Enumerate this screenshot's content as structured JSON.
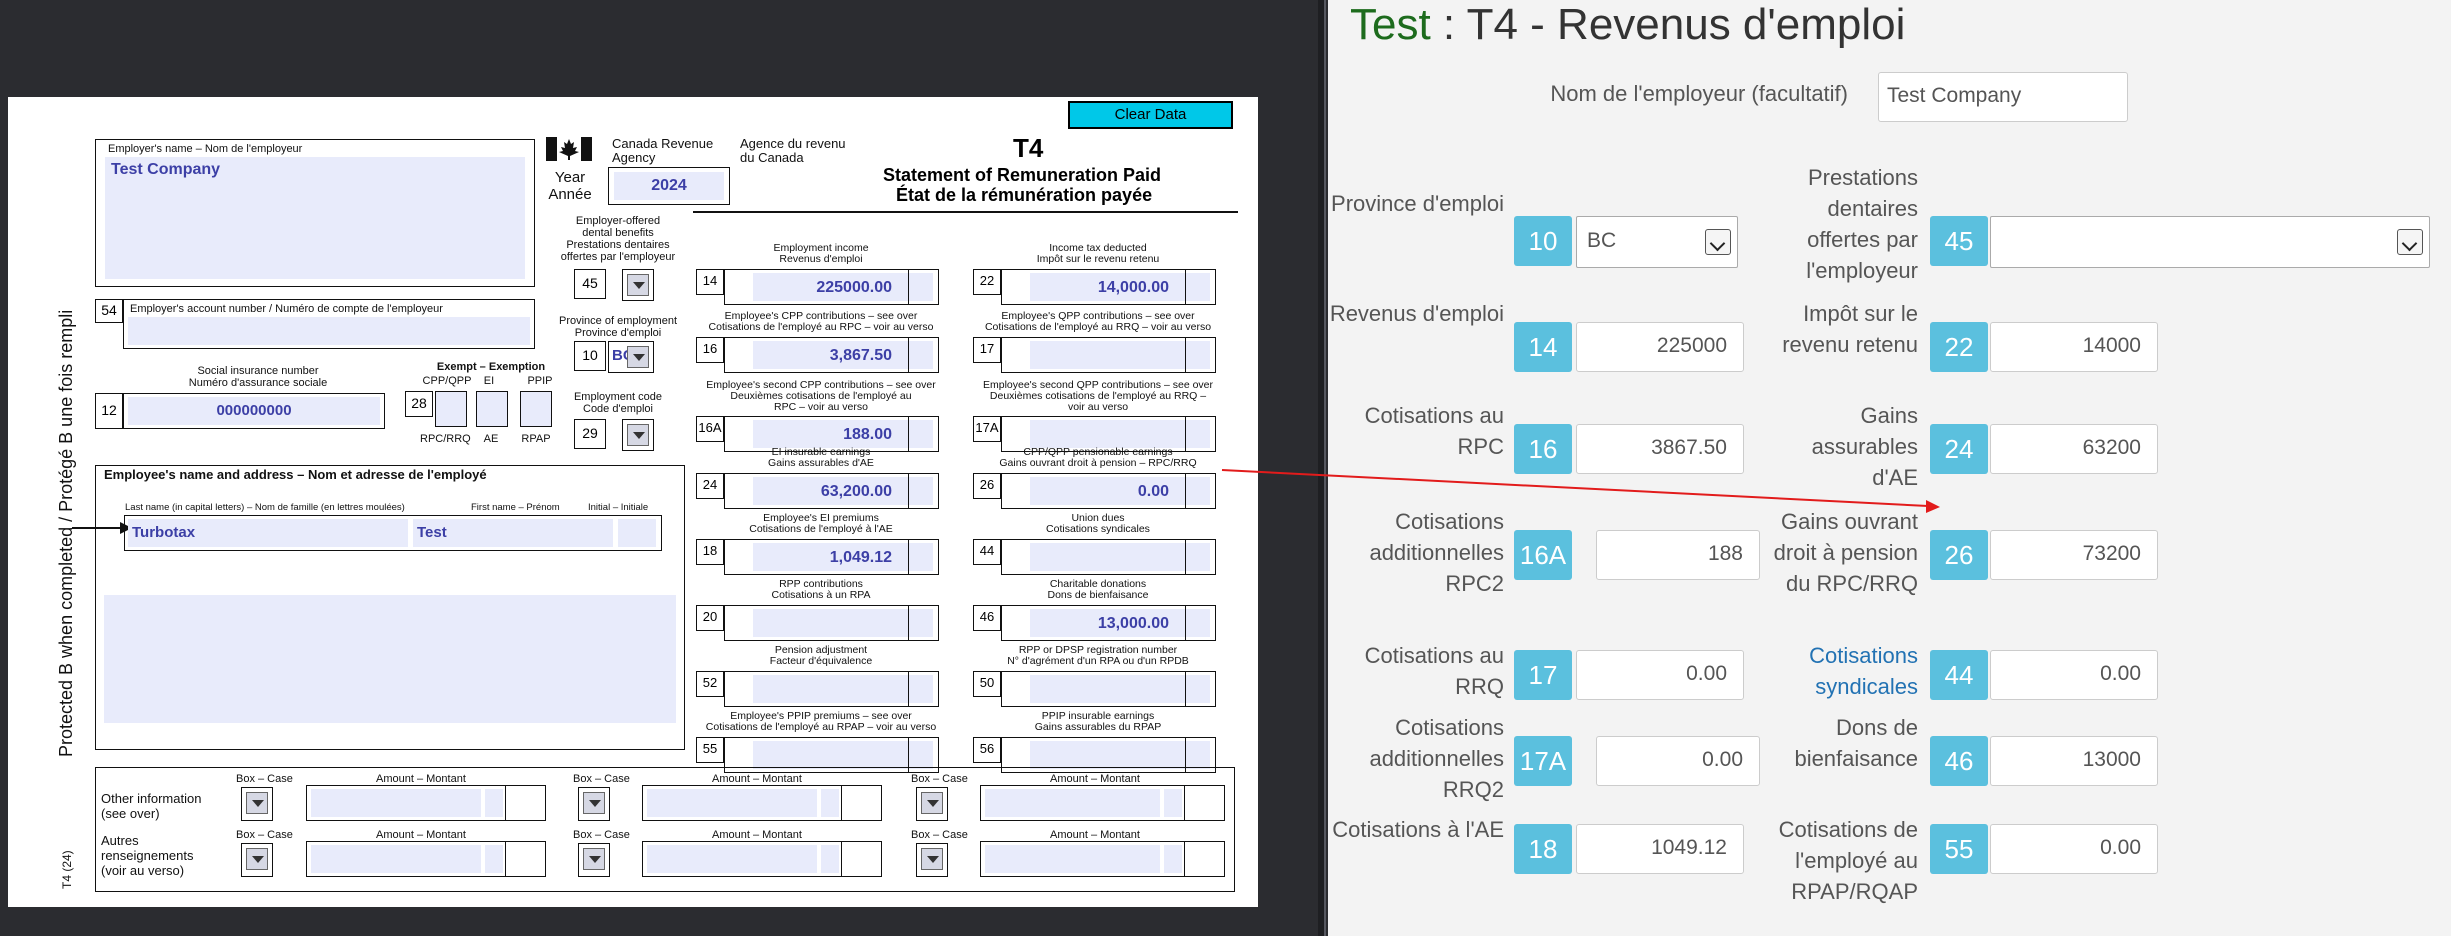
{
  "pdf": {
    "clear_button": "Clear Data",
    "employer_name_label": "Employer's name – Nom de l'employeur",
    "employer_name": "Test Company",
    "cra_en": "Canada Revenue",
    "cra_en2": "Agency",
    "cra_fr": "Agence du revenu",
    "cra_fr2": "du Canada",
    "form_code": "T4",
    "year_label": "Year",
    "year_label_fr": "Année",
    "year": "2024",
    "title_en": "Statement of Remuneration Paid",
    "title_fr": "État de la rémunération payée",
    "dental_label1": "Employer-offered",
    "dental_label2": "dental benefits",
    "dental_label3": "Prestations dentaires",
    "dental_label4": "offertes par l'employeur",
    "box45": "45",
    "province_label1": "Province of employment",
    "province_label2": "Province d'emploi",
    "box10": "10",
    "province": "BC",
    "emp_code_label1": "Employment code",
    "emp_code_label2": "Code d'emploi",
    "box29": "29",
    "account_label": "Employer's account number / Numéro de compte de l'employeur",
    "box54": "54",
    "sin_label1": "Social insurance number",
    "sin_label2": "Numéro d'assurance sociale",
    "box12": "12",
    "sin": "000000000",
    "exempt_label": "Exempt – Exemption",
    "exempt_cols": [
      "CPP/QPP",
      "EI",
      "PPIP"
    ],
    "exempt_bottom": [
      "RPC/RRQ",
      "AE",
      "RPAP"
    ],
    "box28": "28",
    "employee_label": "Employee's name and address – Nom et adresse de l'employé",
    "lastname_label": "Last name (in capital letters) – Nom de famille (en lettres moulées)",
    "firstname_label": "First name – Prénom",
    "initial_label": "Initial – Initiale",
    "last_name": "Turbotax",
    "first_name": "Test",
    "side_text": "Protected B when completed / Protégé B une fois rempli",
    "side_code": "T4 (24)",
    "boxes": [
      {
        "num": "14",
        "l1": "Employment income",
        "l2": "Revenus d'emploi",
        "l3": "",
        "value": "225000.00"
      },
      {
        "num": "22",
        "l1": "Income tax deducted",
        "l2": "Impôt sur le revenu retenu",
        "l3": "",
        "value": "14,000.00"
      },
      {
        "num": "16",
        "l1": "Employee's CPP contributions – see over",
        "l2": "Cotisations de l'employé au RPC – voir au verso",
        "l3": "",
        "value": "3,867.50"
      },
      {
        "num": "17",
        "l1": "Employee's QPP contributions – see over",
        "l2": "Cotisations de l'employé au RRQ – voir au verso",
        "l3": "",
        "value": ""
      },
      {
        "num": "16A",
        "l1": "Employee's second CPP contributions – see over",
        "l2": "Deuxièmes cotisations de l'employé au",
        "l3": "RPC – voir au verso",
        "value": "188.00"
      },
      {
        "num": "17A",
        "l1": "Employee's second QPP contributions – see over",
        "l2": "Deuxièmes cotisations de l'employé au RRQ –",
        "l3": "voir au verso",
        "value": ""
      },
      {
        "num": "24",
        "l1": "EI insurable earnings",
        "l2": "Gains assurables d'AE",
        "l3": "",
        "value": "63,200.00"
      },
      {
        "num": "26",
        "l1": "CPP/QPP pensionable earnings",
        "l2": "Gains ouvrant droit à pension – RPC/RRQ",
        "l3": "",
        "value": "0.00"
      },
      {
        "num": "18",
        "l1": "Employee's EI premiums",
        "l2": "Cotisations de l'employé à l'AE",
        "l3": "",
        "value": "1,049.12"
      },
      {
        "num": "44",
        "l1": "Union dues",
        "l2": "Cotisations syndicales",
        "l3": "",
        "value": ""
      },
      {
        "num": "20",
        "l1": "RPP contributions",
        "l2": "Cotisations à un RPA",
        "l3": "",
        "value": ""
      },
      {
        "num": "46",
        "l1": "Charitable donations",
        "l2": "Dons de bienfaisance",
        "l3": "",
        "value": "13,000.00"
      },
      {
        "num": "52",
        "l1": "Pension adjustment",
        "l2": "Facteur d'équivalence",
        "l3": "",
        "value": ""
      },
      {
        "num": "50",
        "l1": "RPP or DPSP registration number",
        "l2": "N° d'agrément d'un RPA ou d'un RPDB",
        "l3": "",
        "value": ""
      },
      {
        "num": "55",
        "l1": "Employee's PPIP premiums – see over",
        "l2": "Cotisations de l'employé au RPAP – voir au verso",
        "l3": "",
        "value": ""
      },
      {
        "num": "56",
        "l1": "PPIP insurable earnings",
        "l2": "Gains assurables du RPAP",
        "l3": "",
        "value": ""
      }
    ],
    "other_info_en1": "Other information",
    "other_info_en2": "(see over)",
    "other_info_fr1": "Autres",
    "other_info_fr2": "renseignements",
    "other_info_fr3": "(voir au verso)",
    "box_case": "Box – Case",
    "amount_montant": "Amount – Montant"
  },
  "panel": {
    "title_prefix": "Test",
    "title_sep": " : ",
    "title_main": "T4 - Revenus d'emploi",
    "employer_label": "Nom de l'employeur (facultatif)",
    "employer_value": "Test Company",
    "rows": [
      {
        "l_label": "Province d'emploi",
        "l_num": "10",
        "l_value": "BC",
        "r_label": "Prestations dentaires offertes par l'employeur",
        "r_num": "45",
        "r_value": ""
      },
      {
        "l_label": "Revenus d'emploi",
        "l_num": "14",
        "l_value": "225000",
        "r_label": "Impôt sur le revenu retenu",
        "r_num": "22",
        "r_value": "14000"
      },
      {
        "l_label": "Cotisations au RPC",
        "l_num": "16",
        "l_value": "3867.50",
        "r_label": "Gains assurables d'AE",
        "r_num": "24",
        "r_value": "63200"
      },
      {
        "l_label": "Cotisations additionnelles RPC2",
        "l_num": "16A",
        "l_value": "188",
        "r_label": "Gains ouvrant droit à pension du RPC/RRQ",
        "r_num": "26",
        "r_value": "73200"
      },
      {
        "l_label": "Cotisations au RRQ",
        "l_num": "17",
        "l_value": "0.00",
        "r_label": "Cotisations syndicales",
        "r_num": "44",
        "r_value": "0.00"
      },
      {
        "l_label": "Cotisations additionnelles RRQ2",
        "l_num": "17A",
        "l_value": "0.00",
        "r_label": "Dons de bienfaisance",
        "r_num": "46",
        "r_value": "13000"
      },
      {
        "l_label": "Cotisations à l'AE",
        "l_num": "18",
        "l_value": "1049.12",
        "r_label": "Cotisations de l'employé au RPAP/RQAP",
        "r_num": "55",
        "r_value": "0.00"
      }
    ]
  },
  "colors": {
    "badge": "#5bc0de",
    "link": "#2272b3",
    "title_green": "#1d6b1d",
    "arrow": "#e21b1b",
    "field_bg": "#e8ebfb",
    "field_text": "#3c3fa6"
  }
}
